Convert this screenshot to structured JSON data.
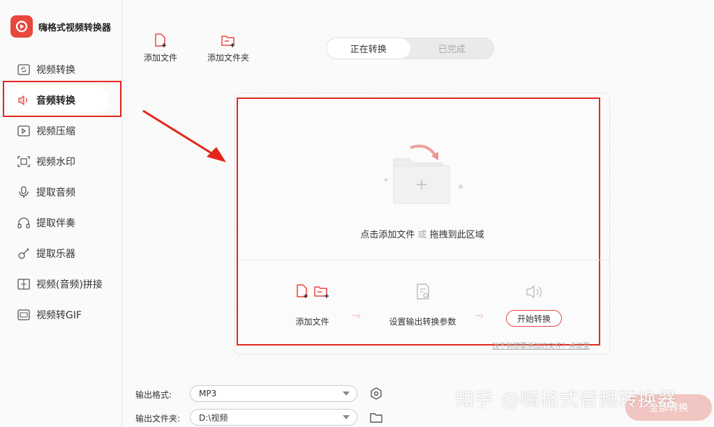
{
  "app": {
    "name": "嗨格式视频转换器"
  },
  "sidebar": {
    "items": [
      {
        "label": "视频转换",
        "icon": "video-convert-icon",
        "active": false
      },
      {
        "label": "音频转换",
        "icon": "audio-speaker-icon",
        "active": true
      },
      {
        "label": "视频压缩",
        "icon": "video-compress-icon",
        "active": false
      },
      {
        "label": "视频水印",
        "icon": "watermark-icon",
        "active": false
      },
      {
        "label": "提取音频",
        "icon": "microphone-icon",
        "active": false
      },
      {
        "label": "提取伴奏",
        "icon": "headphone-icon",
        "active": false
      },
      {
        "label": "提取乐器",
        "icon": "guitar-icon",
        "active": false
      },
      {
        "label": "视频(音频)拼接",
        "icon": "merge-icon",
        "active": false
      },
      {
        "label": "视频转GIF",
        "icon": "gif-icon",
        "active": false
      }
    ]
  },
  "toolbar": {
    "add_file": "添加文件",
    "add_folder": "添加文件夹"
  },
  "tabs": [
    {
      "label": "正在转换",
      "active": true
    },
    {
      "label": "已完成",
      "active": false
    }
  ],
  "drop": {
    "hint_left": "点击添加文件",
    "hint_or": "或",
    "hint_right": "拖拽到此区域"
  },
  "steps": {
    "add_file": "添加文件",
    "settings": "设置输出转换参数",
    "start": "开始转换"
  },
  "help_link": "找不到想要添加的文件？点这里",
  "output": {
    "format_label": "输出格式:",
    "format_value": "MP3",
    "folder_label": "输出文件夹:",
    "folder_value": "D:\\视频"
  },
  "convert_all": "全部转换",
  "watermark": "知乎 @嗨格式音频转换器",
  "colors": {
    "accent": "#e8473c",
    "annotation": "#e3261b"
  }
}
